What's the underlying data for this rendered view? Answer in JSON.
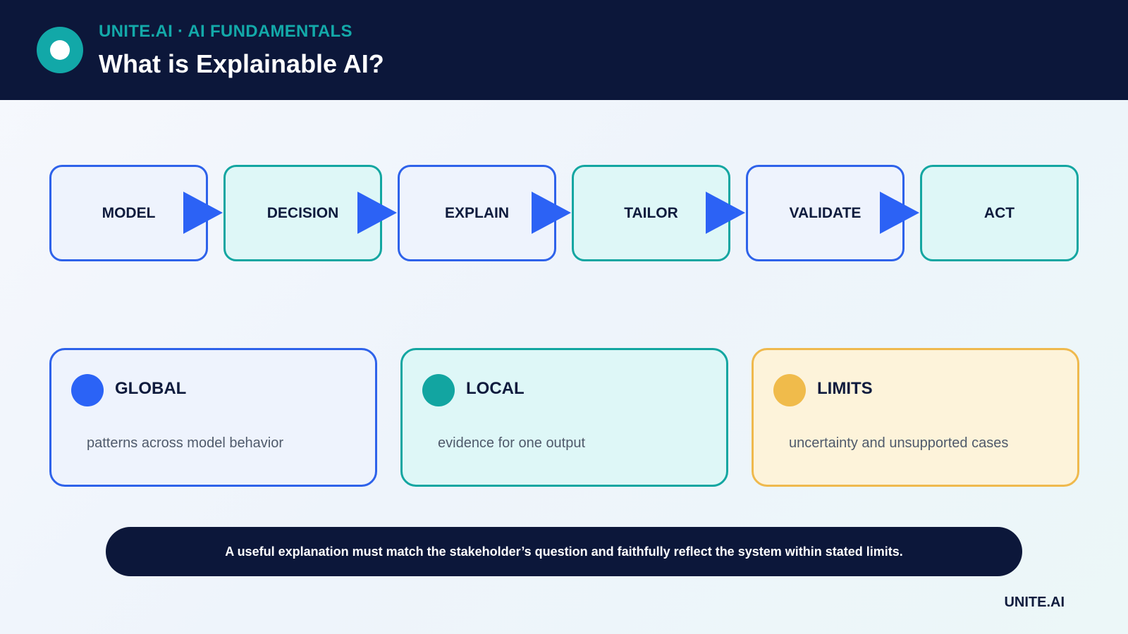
{
  "header": {
    "eyebrow": "UNITE.AI · AI FUNDAMENTALS",
    "title": "What is Explainable AI?",
    "logo_icon": "circle-ring-icon"
  },
  "flow": {
    "steps": [
      {
        "label": "MODEL",
        "style": "blue"
      },
      {
        "label": "DECISION",
        "style": "teal"
      },
      {
        "label": "EXPLAIN",
        "style": "blue"
      },
      {
        "label": "TAILOR",
        "style": "teal"
      },
      {
        "label": "VALIDATE",
        "style": "blue"
      },
      {
        "label": "ACT",
        "style": "teal"
      }
    ],
    "arrow_icon": "triangle-right-icon"
  },
  "cards": [
    {
      "title": "GLOBAL",
      "description": "patterns across model behavior",
      "dot_color": "#2b63f6"
    },
    {
      "title": "LOCAL",
      "description": "evidence for one output",
      "dot_color": "#12a5a1"
    },
    {
      "title": "LIMITS",
      "description": "uncertainty and unsupported cases",
      "dot_color": "#f0bb4b"
    }
  ],
  "banner": {
    "text": "A useful explanation must match the stakeholder’s question and faithfully reflect the system within stated limits."
  },
  "footer": {
    "brand": "UNITE.AI"
  },
  "colors": {
    "navy": "#0c173a",
    "blue_accent": "#2c62f5",
    "teal_accent": "#13a9a9",
    "amber_accent": "#efb94d"
  }
}
